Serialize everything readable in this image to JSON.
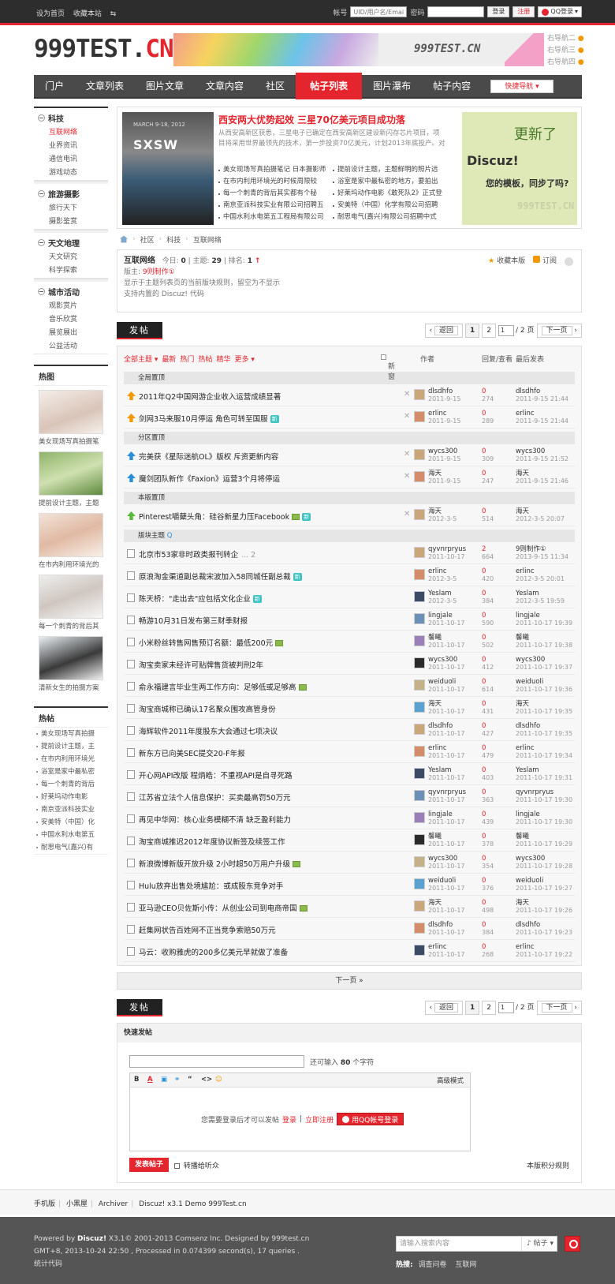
{
  "topbar": {
    "set_home": "设为首页",
    "bookmark": "收藏本站",
    "account_label": "帐号",
    "account_placeholder": "UID/用户名/Email",
    "password_label": "密码",
    "login": "登录",
    "register": "注册",
    "qq_login": "QQ登录"
  },
  "logo": {
    "main": "999TEST.",
    "suffix": "CN"
  },
  "banner": {
    "text": "999TEST.CN"
  },
  "right_nav": [
    "右导航二",
    "右导航三",
    "右导航四"
  ],
  "nav": {
    "items": [
      "门户",
      "文章列表",
      "图片文章",
      "文章内容",
      "社区",
      "帖子列表",
      "图片瀑布",
      "帖子内容"
    ],
    "quick": "快捷导航"
  },
  "sidebar": {
    "groups": [
      {
        "title": "科技",
        "items": [
          "互联网络",
          "业界资讯",
          "通信电讯",
          "游戏动态"
        ]
      },
      {
        "title": "旅游摄影",
        "items": [
          "旅行天下",
          "摄影鉴赏"
        ]
      },
      {
        "title": "天文地理",
        "items": [
          "天文研究",
          "科学探索"
        ]
      },
      {
        "title": "城市活动",
        "items": [
          "观影赏片",
          "音乐欣赏",
          "展览展出",
          "公益活动"
        ]
      }
    ]
  },
  "hotpics": {
    "title": "热图",
    "captions": [
      "美女现场写真拍摄笔",
      "提前设计主题，主题",
      "在市内利用环境光的",
      "每一个刺青的背后其",
      "清新女生的拍摄方案"
    ]
  },
  "hotlist": {
    "title": "热帖",
    "items": [
      "美女现场写真拍摄",
      "提前设计主题，主",
      "在市内利用环境光",
      "浴室是家中最私密",
      "每一个刺青的背后",
      "好莱坞动作电影",
      "南京亚派科技实业",
      "安美特（中国）化",
      "中国水利水电第五",
      "耐思电气(嘉兴)有"
    ]
  },
  "feature": {
    "date": "MARCH 9-18, 2012",
    "sxsw": "SXSW",
    "title": "西安两大优势起效 三星70亿美元项目成功落",
    "desc": "从西安高新区获悉，三星电子已确定在西安高新区建设新闪存芯片项目，项目将采用世界最领先的技术，第一步投资70亿美元，计划2013年底投产。对此，",
    "links": [
      "美女现场写真拍摄笔记 日本摄影师",
      "提前设计主题，主题鲜明的照片远",
      "在市内利用环境光的时候周限较",
      "浴室是家中最私密的地方，要拍出",
      "每一个刺青的背后其实都有个秘",
      "好莱坞动作电影《敢死队2》正式登",
      "南京亚派科技实业有限公司招聘五",
      "安美特（中国）化学有限公司招聘",
      "中国水利水电第五工程局有限公司",
      "耐思电气(嘉兴)有限公司招聘中式"
    ],
    "ad": {
      "t1": "更新了",
      "t2": "Discuz!",
      "t3": "您的模板，同步了吗?",
      "t4": "999TEST.CN"
    }
  },
  "breadcrumb": [
    "社区",
    "科技",
    "互联网络"
  ],
  "forum": {
    "name": "互联网络",
    "today_label": "今日:",
    "today": "0",
    "topics_label": "主题:",
    "topics": "29",
    "rank_label": "排名:",
    "rank": "1",
    "moderator_label": "版主:",
    "moderator": "9则制作①",
    "desc1": "显示于主题列表页的当前版块规则，留空为不显示",
    "desc2": "支持内置的 Discuz! 代码",
    "favorite": "收藏本版",
    "subscribe": "订阅"
  },
  "toolbar": {
    "post": "发帖",
    "back": "返回",
    "pages": [
      "1",
      "2"
    ],
    "page_input": "1",
    "total": "/ 2 页",
    "next": "下一页"
  },
  "filters": {
    "all": "全部主题",
    "items": [
      "最新",
      "热门",
      "热帖",
      "精华",
      "更多"
    ],
    "new_win": "新窗",
    "col_author": "作者",
    "col_reply": "回复/查看",
    "col_last": "最后发表"
  },
  "sections": {
    "global": "全局置顶",
    "category": "分区置顶",
    "forum": "本版置顶",
    "threads": "版块主题"
  },
  "global_rows": [
    {
      "title": "2011年Q2中国网游企业收入运营成绩显著",
      "tag": "",
      "img": false,
      "author": "dlsdhfo",
      "date": "2011-9-15",
      "replies": "0",
      "views": "274",
      "last": "dlsdhfo",
      "last_date": "2011-9-15 21:44"
    },
    {
      "title": "剑网3马来服10月停运 角色可转至国服",
      "tag": "新",
      "img": false,
      "author": "erlinc",
      "date": "2011-9-15",
      "replies": "0",
      "views": "289",
      "last": "erlinc",
      "last_date": "2011-9-15 21:44"
    }
  ],
  "category_rows": [
    {
      "title": "完美获《星际迷航OL》版权 斥资更新内容",
      "tag": "",
      "img": false,
      "author": "wycs300",
      "date": "2011-9-15",
      "replies": "0",
      "views": "309",
      "last": "wycs300",
      "last_date": "2011-9-15 21:52"
    },
    {
      "title": "魔剑团队新作《Faxion》运营3个月将停运",
      "tag": "",
      "img": false,
      "author": "海天",
      "date": "2011-9-15",
      "replies": "0",
      "views": "247",
      "last": "海天",
      "last_date": "2011-9-15 21:46"
    }
  ],
  "forum_rows": [
    {
      "title": "Pinterest嚼蘖头角：硅谷新星力压Facebook",
      "tag": "新",
      "img": true,
      "author": "海天",
      "date": "2012-3-5",
      "replies": "0",
      "views": "514",
      "last": "海天",
      "last_date": "2012-3-5 20:07"
    }
  ],
  "thread_rows": [
    {
      "title": "北京市53家非时政类报刊转企",
      "extra": "... 2",
      "tag": "",
      "img": false,
      "author": "qyvnrpryus",
      "date": "2011-10-17",
      "replies": "2",
      "views": "664",
      "last": "9则制作①",
      "last_date": "2013-9-15 11:34"
    },
    {
      "title": "原浪淘金渠道副总裁宋波加入58同城任副总裁",
      "extra": "",
      "tag": "新",
      "img": false,
      "author": "erlinc",
      "date": "2012-3-5",
      "replies": "0",
      "views": "420",
      "last": "erlinc",
      "last_date": "2012-3-5 20:01"
    },
    {
      "title": "陈天桥：\"走出去\"应包括文化企业",
      "extra": "",
      "tag": "新",
      "img": false,
      "author": "Yeslam",
      "date": "2012-3-5",
      "replies": "0",
      "views": "384",
      "last": "Yeslam",
      "last_date": "2012-3-5 19:59"
    },
    {
      "title": "畅游10月31日发布第三财季财报",
      "extra": "",
      "tag": "",
      "img": false,
      "author": "lingjale",
      "date": "2011-10-17",
      "replies": "0",
      "views": "590",
      "last": "lingjale",
      "last_date": "2011-10-17 19:39"
    },
    {
      "title": "小米粉丝转售网售预订名额：最低200元",
      "extra": "",
      "tag": "",
      "img": true,
      "author": "馨曦",
      "date": "2011-10-17",
      "replies": "0",
      "views": "502",
      "last": "馨曦",
      "last_date": "2011-10-17 19:38"
    },
    {
      "title": "淘宝卖家未经许可贴牌售货被判刑2年",
      "extra": "",
      "tag": "",
      "img": false,
      "author": "wycs300",
      "date": "2011-10-17",
      "replies": "0",
      "views": "412",
      "last": "wycs300",
      "last_date": "2011-10-17 19:37"
    },
    {
      "title": "俞永福建言毕业生两工作方向：足够低或足够高",
      "extra": "",
      "tag": "",
      "img": true,
      "author": "weiduoli",
      "date": "2011-10-17",
      "replies": "0",
      "views": "614",
      "last": "weiduoli",
      "last_date": "2011-10-17 19:36"
    },
    {
      "title": "淘宝商城称已确认17名聚众围攻高管身份",
      "extra": "",
      "tag": "",
      "img": false,
      "author": "海天",
      "date": "2011-10-17",
      "replies": "0",
      "views": "431",
      "last": "海天",
      "last_date": "2011-10-17 19:35"
    },
    {
      "title": "海辉软件2011年度股东大会通过七项决议",
      "extra": "",
      "tag": "",
      "img": false,
      "author": "dlsdhfo",
      "date": "2011-10-17",
      "replies": "0",
      "views": "427",
      "last": "dlsdhfo",
      "last_date": "2011-10-17 19:35"
    },
    {
      "title": "新东方已向美SEC提交20-F年报",
      "extra": "",
      "tag": "",
      "img": false,
      "author": "erlinc",
      "date": "2011-10-17",
      "replies": "0",
      "views": "479",
      "last": "erlinc",
      "last_date": "2011-10-17 19:34"
    },
    {
      "title": "开心网API改版 程炳皓：不重视API是自寻死路",
      "extra": "",
      "tag": "",
      "img": false,
      "author": "Yeslam",
      "date": "2011-10-17",
      "replies": "0",
      "views": "403",
      "last": "Yeslam",
      "last_date": "2011-10-17 19:31"
    },
    {
      "title": "江苏省立法个人信息保护：买卖最高罚50万元",
      "extra": "",
      "tag": "",
      "img": false,
      "author": "qyvnrpryus",
      "date": "2011-10-17",
      "replies": "0",
      "views": "363",
      "last": "qyvnrpryus",
      "last_date": "2011-10-17 19:30"
    },
    {
      "title": "再见中华网：核心业务模糊不清 缺乏盈利能力",
      "extra": "",
      "tag": "",
      "img": false,
      "author": "lingjale",
      "date": "2011-10-17",
      "replies": "0",
      "views": "439",
      "last": "lingjale",
      "last_date": "2011-10-17 19:30"
    },
    {
      "title": "淘宝商城推迟2012年度协议新签及续签工作",
      "extra": "",
      "tag": "",
      "img": false,
      "author": "馨曦",
      "date": "2011-10-17",
      "replies": "0",
      "views": "378",
      "last": "馨曦",
      "last_date": "2011-10-17 19:29"
    },
    {
      "title": "新浪微博新版开放升级 2小时超50万用户升级",
      "extra": "",
      "tag": "",
      "img": true,
      "author": "wycs300",
      "date": "2011-10-17",
      "replies": "0",
      "views": "354",
      "last": "wycs300",
      "last_date": "2011-10-17 19:28"
    },
    {
      "title": "Hulu放弃出售处境尴尬：或成股东竞争对手",
      "extra": "",
      "tag": "",
      "img": false,
      "author": "weiduoli",
      "date": "2011-10-17",
      "replies": "0",
      "views": "376",
      "last": "weiduoli",
      "last_date": "2011-10-17 19:27"
    },
    {
      "title": "亚马逊CEO贝佐斯小传：从创业公司到电商帝国",
      "extra": "",
      "tag": "",
      "img": true,
      "author": "海天",
      "date": "2011-10-17",
      "replies": "0",
      "views": "498",
      "last": "海天",
      "last_date": "2011-10-17 19:26"
    },
    {
      "title": "赶集网状告百姓网不正当竞争索赔50万元",
      "extra": "",
      "tag": "",
      "img": false,
      "author": "dlsdhfo",
      "date": "2011-10-17",
      "replies": "0",
      "views": "384",
      "last": "dlsdhfo",
      "last_date": "2011-10-17 19:23"
    },
    {
      "title": "马云：收购雅虎的200多亿美元早就做了准备",
      "extra": "",
      "tag": "",
      "img": false,
      "author": "erlinc",
      "date": "2011-10-17",
      "replies": "0",
      "views": "268",
      "last": "erlinc",
      "last_date": "2011-10-17 19:22"
    }
  ],
  "next_page": "下一页 »",
  "quickpost": {
    "title": "快速发帖",
    "can_input": "还可输入",
    "limit": "80",
    "unit": "个字符",
    "advanced": "高级模式",
    "msg": "您需要登录后才可以发帖",
    "login": "登录",
    "sep": "|",
    "register": "立即注册",
    "qq_login": "用QQ帐号登录",
    "submit": "发表帖子",
    "sync": "转播给听众",
    "rules": "本版积分规则"
  },
  "footer_links": [
    "手机版",
    "小黑屋",
    "Archiver",
    "Discuz! x3.1 Demo 999Test.cn"
  ],
  "footer": {
    "powered_prefix": "Powered by",
    "powered_brand": "Discuz!",
    "powered_rest": "X3.1© 2001-2013 Comsenz Inc. Designed by 999test.cn",
    "gmt": "GMT+8, 2013-10-24 22:50 , Processed in 0.074399 second(s), 17 queries .",
    "stat": "统计代码",
    "search_placeholder": "请输入搜索内容",
    "search_type": "帖子",
    "hot_label": "热搜:",
    "hot_words": [
      "调查问卷",
      "互联网"
    ]
  },
  "colors": {
    "accent": "#e4252d",
    "nav_bg": "#4a4a4a",
    "footer_bg": "#555555"
  }
}
